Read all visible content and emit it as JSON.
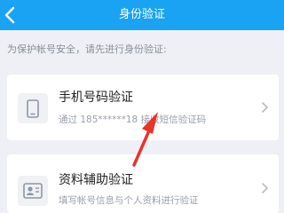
{
  "header": {
    "title": "身份验证",
    "background": "#1aa3f2"
  },
  "tip": "为保护帐号安全，请先进行身份验证:",
  "options": [
    {
      "title": "手机号码验证",
      "subtitle": "通过 185******18 接收短信验证码",
      "icon": "phone-icon"
    },
    {
      "title": "资料辅助验证",
      "subtitle": "填写帐号信息与个人资料进行验证",
      "icon": "id-card-icon"
    }
  ],
  "annotation": {
    "type": "red-arrow",
    "color": "#e8342a",
    "points_to": "phone number"
  }
}
